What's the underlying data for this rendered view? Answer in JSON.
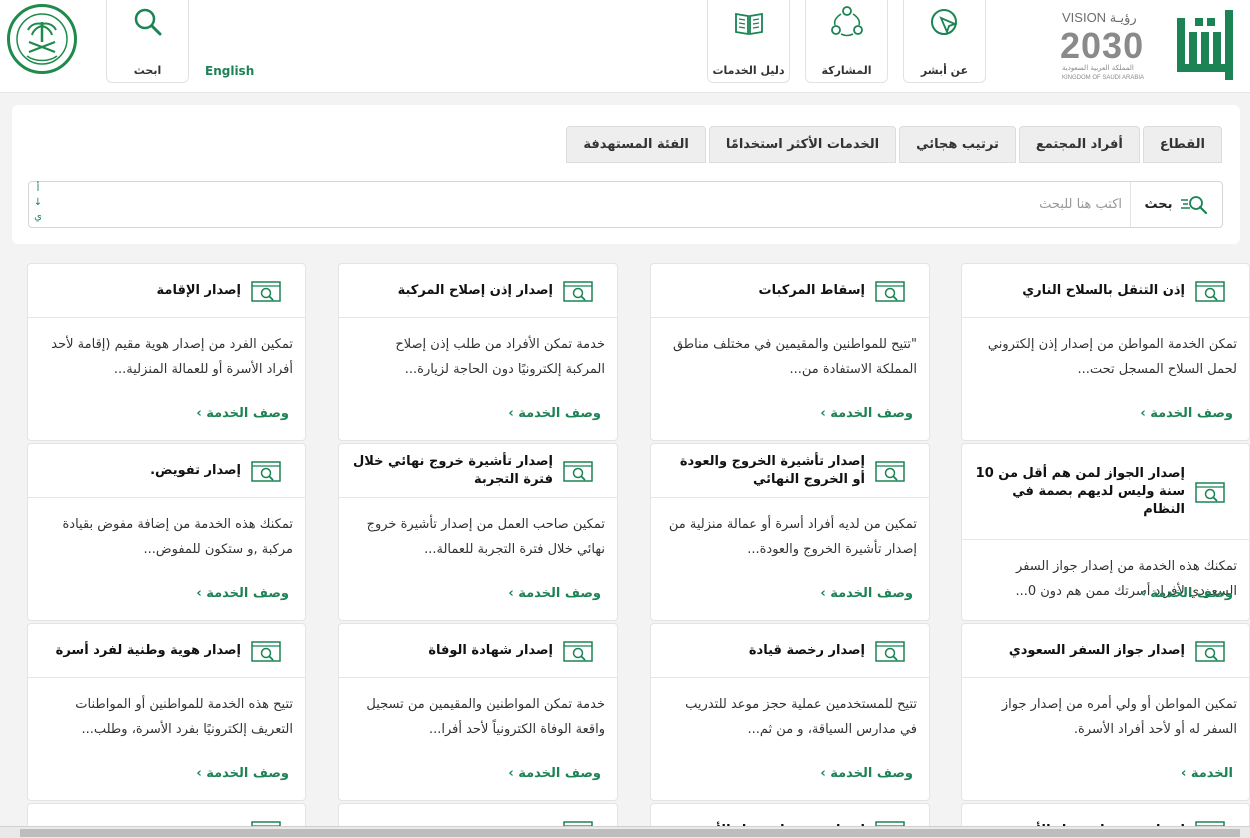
{
  "header": {
    "english_label": "English",
    "search_label": "ابحث",
    "services_guide_label": "دليل الخدمات",
    "participation_label": "المشاركة",
    "about_label": "عن أبشر",
    "vision": {
      "line1": "VISION رؤيـة",
      "line2": "2030",
      "ar": "المملكة العربية السعودية",
      "en": "KINGDOM OF SAUDI ARABIA"
    }
  },
  "filter": {
    "tabs": [
      "القطاع",
      "أفراد المجتمع",
      "ترتيب هجائي",
      "الخدمات الأكثر استخدامًا",
      "الفئة المستهدفة"
    ],
    "search_button": "بحث",
    "search_placeholder": "اكتب هنا للبحث",
    "alpha_top": "أ",
    "alpha_arrow": "↓",
    "alpha_bottom": "ي"
  },
  "link_label": "وصف الخدمة ›",
  "cards": [
    {
      "title": "إذن التنقل بالسلاح الناري",
      "desc": "تمكن الخدمة المواطن من إصدار إذن إلكتروني لحمل السلاح المسجل تحت..."
    },
    {
      "title": "إسقاط المركبات",
      "desc": "\"تتيح للمواطنين والمقيمين في مختلف مناطق المملكة الاستفادة من..."
    },
    {
      "title": "إصدار إذن إصلاح المركبة",
      "desc": "خدمة تمكن الأفراد من طلب إذن إصلاح المركبة إلكترونيًا دون الحاجة لزيارة..."
    },
    {
      "title": "إصدار الإقامة",
      "desc": "تمكين الفرد من إصدار هوية مقيم (إقامة لأحد أفراد الأسرة أو للعمالة المنزلية..."
    },
    {
      "title": "إصدار الجواز لمن هم أقل من 10 سنة وليس لديهم بصمة في النظام",
      "desc": "تمكنك هذه الخدمة من إصدار جواز السفر السعودي لأفراد أسرتك ممن هم دون 0..."
    },
    {
      "title": "إصدار تأشيرة الخروج والعودة أو الخروج النهائي",
      "desc": "تمكين من لديه أفراد أسرة أو عمالة منزلية من إصدار تأشيرة الخروج والعودة..."
    },
    {
      "title": "إصدار تأشيرة خروج نهائي خلال فترة التجربة",
      "desc": "تمكين صاحب العمل من إصدار تأشيرة خروج نهائي خلال فترة التجربة للعمالة..."
    },
    {
      "title": "إصدار تفويض.",
      "desc": "تمكنك هذه الخدمة من إضافة مفوض بقيادة مركبة ,و ستكون للمفوض..."
    },
    {
      "title": "إصدار جواز السفر السعودي",
      "desc": "تمكين المواطن أو ولي أمره من إصدار جواز السفر له أو لأحد أفراد الأسرة."
    },
    {
      "title": "إصدار رخصة قيادة",
      "desc": "تتيح للمستخدمين عملية حجز موعد للتدريب في مدارس السياقة، و من ثم..."
    },
    {
      "title": "إصدار شهادة الوفاة",
      "desc": "خدمة تمكن المواطنين والمقيمين من تسجيل واقعة الوفاة الكترونياً لأحد أفرا..."
    },
    {
      "title": "إصدار هوية وطنية لفرد أسرة",
      "desc": "تتيح هذه الخدمة للمواطنين أو المواطنات التعريف إلكترونيًا بفرد الأسرة، وطلب..."
    },
    {
      "title": "إصدار وتوصيل سجل الأسرة",
      "desc": ""
    },
    {
      "title": "إصدار وتوصيل سجل الأسرة",
      "desc": ""
    },
    {
      "title": "",
      "desc": ""
    },
    {
      "title": "",
      "desc": ""
    }
  ],
  "card9_link": "الخدمة ›",
  "colors": {
    "brand_green": "#1b8354",
    "card_bg": "#ffffff",
    "page_bg": "#f3f3f3"
  }
}
